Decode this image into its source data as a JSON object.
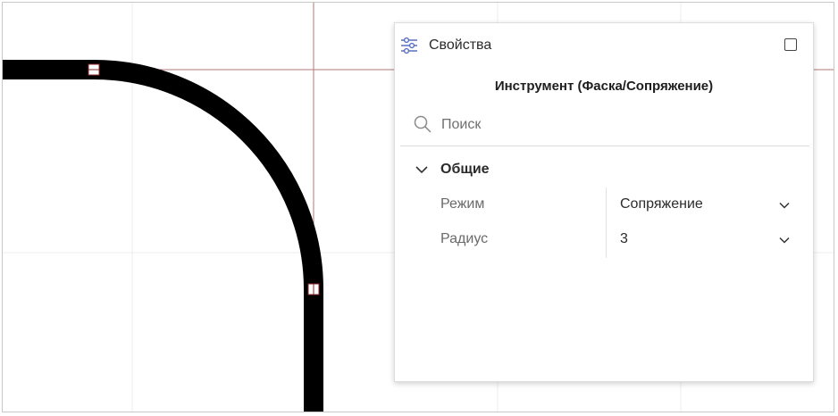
{
  "colors": {
    "stroke": "#000000",
    "guide": "#b07878",
    "grid": "#ececec",
    "accent_icon": "#5a6fc0"
  },
  "panel": {
    "title": "Свойства",
    "title_icon": "sliders-icon",
    "maximize_icon": "maximize-icon",
    "tool_name": "Инструмент (Фаска/Сопряжение)",
    "search": {
      "placeholder": "Поиск",
      "value": ""
    },
    "group": {
      "label": "Общие",
      "expanded": true,
      "properties": [
        {
          "label": "Режим",
          "value": "Сопряжение"
        },
        {
          "label": "Радиус",
          "value": "3"
        }
      ]
    }
  }
}
